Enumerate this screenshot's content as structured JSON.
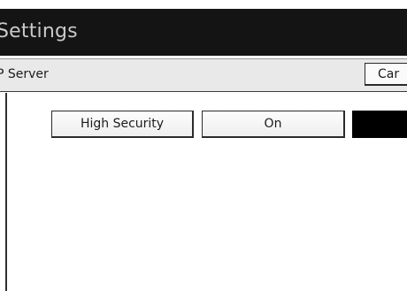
{
  "window": {
    "title": "Settings"
  },
  "subheader": {
    "label": "P Server",
    "cancel_label": "Car"
  },
  "options": [
    {
      "label": "High Security"
    },
    {
      "label": "On"
    },
    {
      "label": ""
    }
  ],
  "colors": {
    "titlebar": "#141414",
    "title_text": "#c9c9c9",
    "selected_option": "#000000"
  }
}
